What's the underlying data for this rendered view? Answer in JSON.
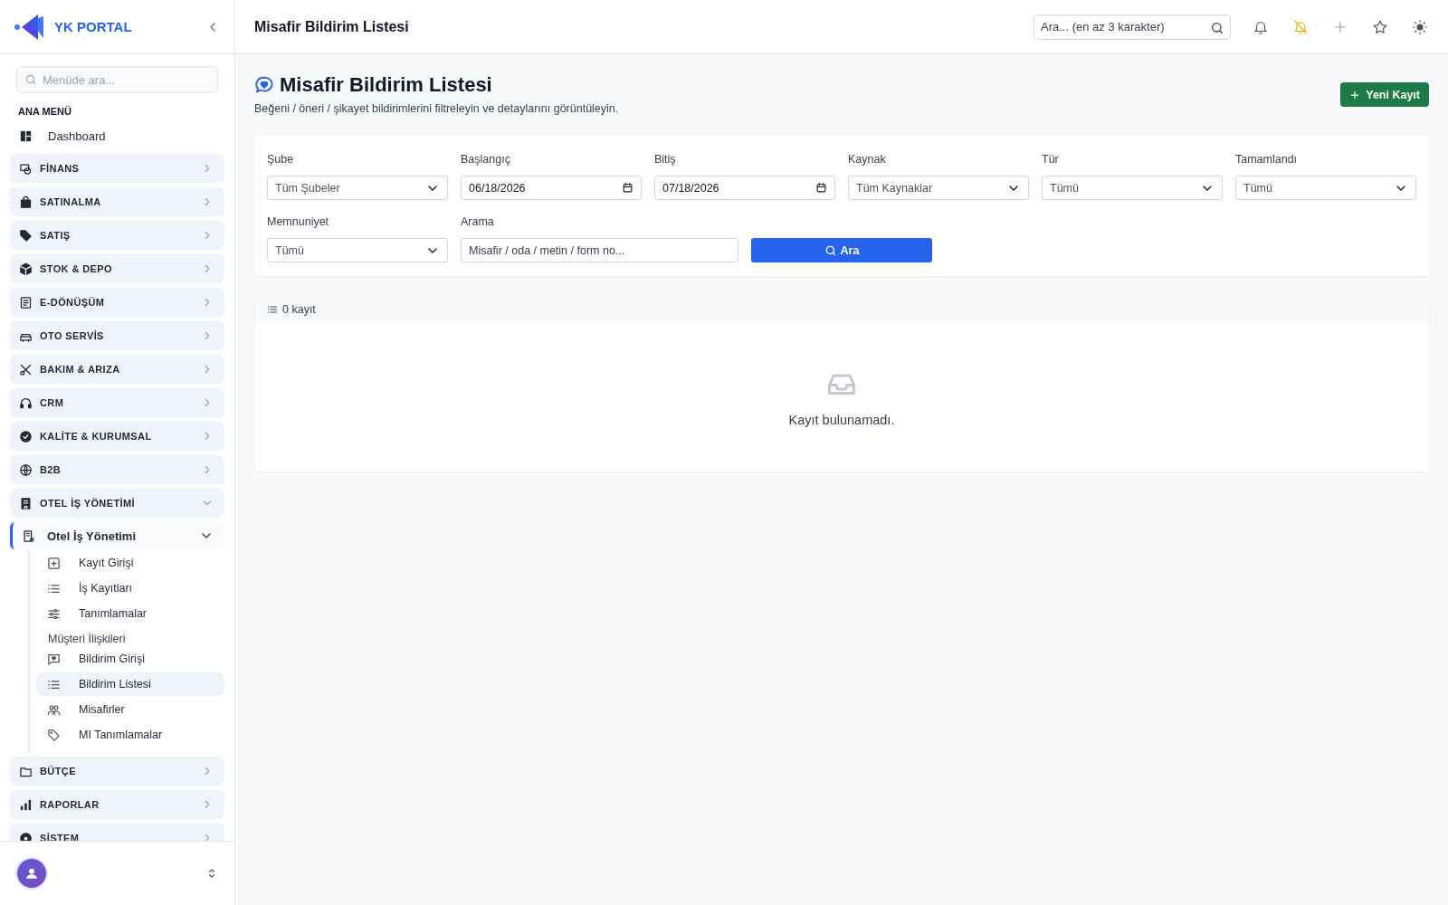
{
  "sidebar": {
    "brand": "YK PORTAL",
    "search": {
      "placeholder": "Menüde ara..."
    },
    "section_label": "ANA MENÜ",
    "items": [
      {
        "kind": "link",
        "label": "Dashboard",
        "selected": false
      },
      {
        "kind": "group",
        "label": "FİNANS",
        "expanded": false
      },
      {
        "kind": "group",
        "label": "SATINALMA",
        "expanded": false
      },
      {
        "kind": "group",
        "label": "SATIŞ",
        "expanded": false
      },
      {
        "kind": "group",
        "label": "STOK & DEPO",
        "expanded": false
      },
      {
        "kind": "group",
        "label": "E-DÖNÜŞÜM",
        "expanded": false
      },
      {
        "kind": "group",
        "label": "OTO SERVİS",
        "expanded": false
      },
      {
        "kind": "group",
        "label": "BAKIM & ARIZA",
        "expanded": false
      },
      {
        "kind": "group",
        "label": "CRM",
        "expanded": false
      },
      {
        "kind": "group",
        "label": "KALİTE & KURUMSAL",
        "expanded": false
      },
      {
        "kind": "group",
        "label": "B2B",
        "expanded": false
      },
      {
        "kind": "group",
        "label": "OTEL İŞ YÖNETİMİ",
        "expanded": true,
        "children": [
          {
            "kind": "submenu",
            "label": "Otel İş Yönetimi",
            "expanded": true,
            "children": [
              {
                "kind": "link",
                "label": "Kayıt Girişi",
                "selected": false
              },
              {
                "kind": "link",
                "label": "İş Kayıtları",
                "selected": false
              },
              {
                "kind": "link",
                "label": "Tanımlamalar",
                "selected": false
              },
              {
                "kind": "heading",
                "label": "Müşteri İlişkileri"
              },
              {
                "kind": "link",
                "label": "Bildirim Girişi",
                "selected": false
              },
              {
                "kind": "link",
                "label": "Bildirim Listesi",
                "selected": true
              },
              {
                "kind": "link",
                "label": "Misafirler",
                "selected": false
              },
              {
                "kind": "link",
                "label": "MI Tanımlamalar",
                "selected": false
              }
            ]
          }
        ]
      },
      {
        "kind": "group",
        "label": "BÜTÇE",
        "expanded": false
      },
      {
        "kind": "group",
        "label": "RAPORLAR",
        "expanded": false
      },
      {
        "kind": "group",
        "label": "SİSTEM",
        "expanded": false
      }
    ]
  },
  "topbar": {
    "title": "Misafir Bildirim Listesi",
    "search": {
      "placeholder": "Ara... (en az 3 karakter)"
    }
  },
  "page": {
    "title": "Misafir Bildirim Listesi",
    "subtitle": "Beğeni / öneri / şikayet bildirimlerini filtreleyin ve detaylarını görüntüleyin.",
    "new_button": "Yeni Kayıt",
    "filters": [
      {
        "kind": "select",
        "label": "Şube",
        "value": "Tüm Şubeler"
      },
      {
        "kind": "date",
        "label": "Başlangıç",
        "value": "06/18/2026"
      },
      {
        "kind": "date",
        "label": "Bitiş",
        "value": "07/18/2026"
      },
      {
        "kind": "select",
        "label": "Kaynak",
        "value": "Tüm Kaynaklar"
      },
      {
        "kind": "select",
        "label": "Tür",
        "value": "Tümü"
      },
      {
        "kind": "select",
        "label": "Tamamlandı",
        "value": "Tümü"
      },
      {
        "kind": "select",
        "label": "Memnuniyet",
        "value": "Tümü"
      },
      {
        "kind": "text",
        "label": "Arama",
        "placeholder": "Misafir / oda / metin / form no..."
      }
    ],
    "search_button": "Ara",
    "results": {
      "count": "0 kayıt",
      "empty_message": "Kayıt bulunamadı."
    }
  }
}
